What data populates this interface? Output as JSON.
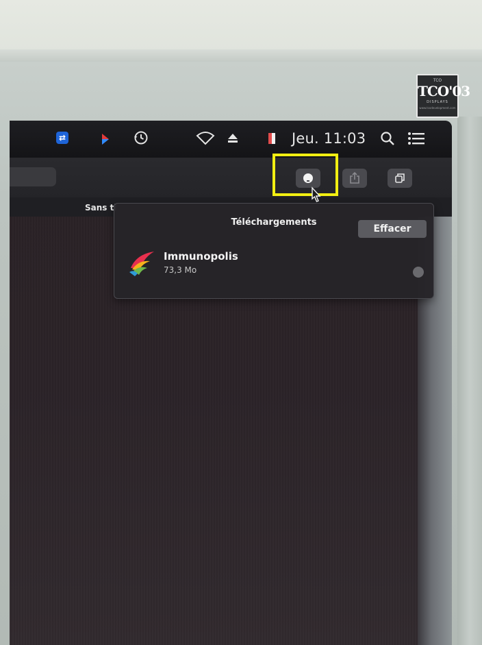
{
  "monitor": {
    "label_brand_top": "TCO",
    "label_main": "TCO'03",
    "label_sub": "DISPLAYS",
    "label_foot": "www.tcodevelopment.com"
  },
  "menubar": {
    "clock": "Jeu. 11:03"
  },
  "tab": {
    "title": "Sans ti"
  },
  "downloads": {
    "title": "Téléchargements",
    "clear_label": "Effacer",
    "items": [
      {
        "name": "Immunopolis",
        "size": "73,3 Mo"
      }
    ]
  },
  "colors": {
    "highlight": "#f2ef12",
    "teamviewer": "#1e64d8",
    "accent_red": "#e23a3a"
  }
}
